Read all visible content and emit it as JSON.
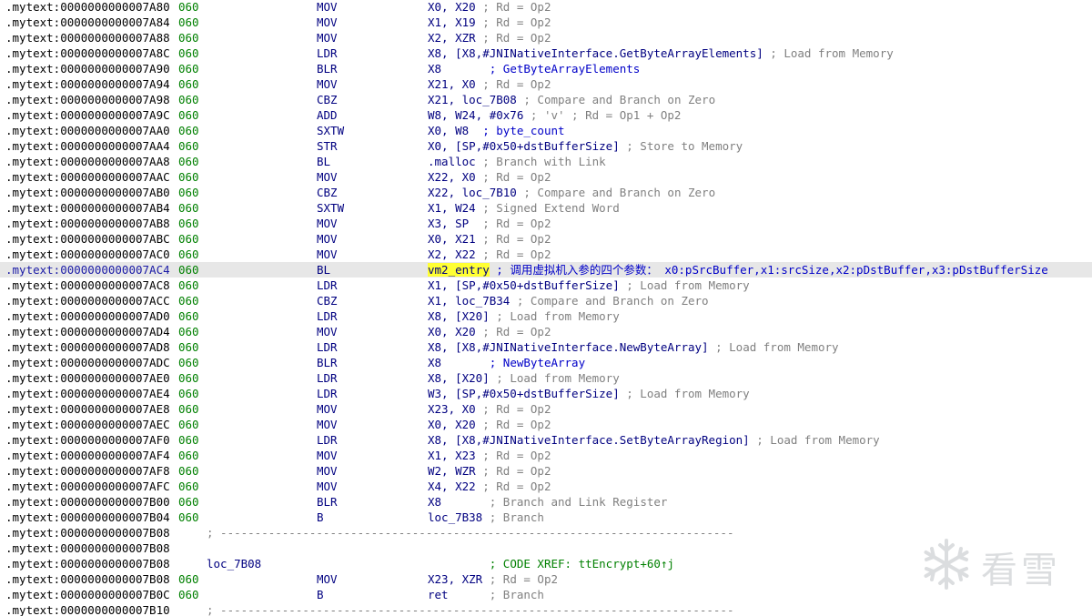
{
  "lines": [
    {
      "addr": ".mytext:0000000000007A80",
      "sp": "060",
      "mnem": "MOV",
      "ops": "X0, X20",
      "comment": "; Rd = Op2"
    },
    {
      "addr": ".mytext:0000000000007A84",
      "sp": "060",
      "mnem": "MOV",
      "ops": "X1, X19",
      "comment": "; Rd = Op2"
    },
    {
      "addr": ".mytext:0000000000007A88",
      "sp": "060",
      "mnem": "MOV",
      "ops": "X2, XZR",
      "comment": "; Rd = Op2"
    },
    {
      "addr": ".mytext:0000000000007A8C",
      "sp": "060",
      "mnem": "LDR",
      "ops": "X8, [X8,#JNINativeInterface.GetByteArrayElements]",
      "comment": "; Load from Memory"
    },
    {
      "addr": ".mytext:0000000000007A90",
      "sp": "060",
      "mnem": "BLR",
      "ops": "X8      ",
      "comment": "; GetByteArrayElements",
      "ctype": "blue"
    },
    {
      "addr": ".mytext:0000000000007A94",
      "sp": "060",
      "mnem": "MOV",
      "ops": "X21, X0",
      "comment": "; Rd = Op2"
    },
    {
      "addr": ".mytext:0000000000007A98",
      "sp": "060",
      "mnem": "CBZ",
      "ops": "X21, loc_7B08",
      "comment": "; Compare and Branch on Zero"
    },
    {
      "addr": ".mytext:0000000000007A9C",
      "sp": "060",
      "mnem": "ADD",
      "ops": "W8, W24, #0x76",
      "comment": "; 'v' ; Rd = Op1 + Op2"
    },
    {
      "addr": ".mytext:0000000000007AA0",
      "sp": "060",
      "mnem": "SXTW",
      "ops": "X0, W8 ",
      "comment": "; byte_count",
      "ctype": "blue"
    },
    {
      "addr": ".mytext:0000000000007AA4",
      "sp": "060",
      "mnem": "STR",
      "ops": "X0, [SP,#0x50+dstBufferSize]",
      "comment": "; Store to Memory"
    },
    {
      "addr": ".mytext:0000000000007AA8",
      "sp": "060",
      "mnem": "BL",
      "ops": ".malloc",
      "comment": "; Branch with Link"
    },
    {
      "addr": ".mytext:0000000000007AAC",
      "sp": "060",
      "mnem": "MOV",
      "ops": "X22, X0",
      "comment": "; Rd = Op2"
    },
    {
      "addr": ".mytext:0000000000007AB0",
      "sp": "060",
      "mnem": "CBZ",
      "ops": "X22, loc_7B10",
      "comment": "; Compare and Branch on Zero"
    },
    {
      "addr": ".mytext:0000000000007AB4",
      "sp": "060",
      "mnem": "SXTW",
      "ops": "X1, W24",
      "comment": "; Signed Extend Word"
    },
    {
      "addr": ".mytext:0000000000007AB8",
      "sp": "060",
      "mnem": "MOV",
      "ops": "X3, SP ",
      "comment": "; Rd = Op2"
    },
    {
      "addr": ".mytext:0000000000007ABC",
      "sp": "060",
      "mnem": "MOV",
      "ops": "X0, X21",
      "comment": "; Rd = Op2"
    },
    {
      "addr": ".mytext:0000000000007AC0",
      "sp": "060",
      "mnem": "MOV",
      "ops": "X2, X22",
      "comment": "; Rd = Op2"
    },
    {
      "addr": ".mytext:0000000000007AC4",
      "sp": "060",
      "mnem": "BL",
      "ops_hl": "vm2_entry",
      "ops": "",
      "comment": "; 调用虚拟机入参的四个参数： x0:pSrcBuffer,x1:srcSize,x2:pDstBuffer,x3:pDstBufferSize",
      "ctype": "blue",
      "current": true
    },
    {
      "addr": ".mytext:0000000000007AC8",
      "sp": "060",
      "mnem": "LDR",
      "ops": "X1, [SP,#0x50+dstBufferSize]",
      "comment": "; Load from Memory"
    },
    {
      "addr": ".mytext:0000000000007ACC",
      "sp": "060",
      "mnem": "CBZ",
      "ops": "X1, loc_7B34",
      "comment": "; Compare and Branch on Zero"
    },
    {
      "addr": ".mytext:0000000000007AD0",
      "sp": "060",
      "mnem": "LDR",
      "ops": "X8, [X20]",
      "comment": "; Load from Memory"
    },
    {
      "addr": ".mytext:0000000000007AD4",
      "sp": "060",
      "mnem": "MOV",
      "ops": "X0, X20",
      "comment": "; Rd = Op2"
    },
    {
      "addr": ".mytext:0000000000007AD8",
      "sp": "060",
      "mnem": "LDR",
      "ops": "X8, [X8,#JNINativeInterface.NewByteArray]",
      "comment": "; Load from Memory"
    },
    {
      "addr": ".mytext:0000000000007ADC",
      "sp": "060",
      "mnem": "BLR",
      "ops": "X8      ",
      "comment": "; NewByteArray",
      "ctype": "blue"
    },
    {
      "addr": ".mytext:0000000000007AE0",
      "sp": "060",
      "mnem": "LDR",
      "ops": "X8, [X20]",
      "comment": "; Load from Memory"
    },
    {
      "addr": ".mytext:0000000000007AE4",
      "sp": "060",
      "mnem": "LDR",
      "ops": "W3, [SP,#0x50+dstBufferSize]",
      "comment": "; Load from Memory"
    },
    {
      "addr": ".mytext:0000000000007AE8",
      "sp": "060",
      "mnem": "MOV",
      "ops": "X23, X0",
      "comment": "; Rd = Op2"
    },
    {
      "addr": ".mytext:0000000000007AEC",
      "sp": "060",
      "mnem": "MOV",
      "ops": "X0, X20",
      "comment": "; Rd = Op2"
    },
    {
      "addr": ".mytext:0000000000007AF0",
      "sp": "060",
      "mnem": "LDR",
      "ops": "X8, [X8,#JNINativeInterface.SetByteArrayRegion]",
      "comment": "; Load from Memory"
    },
    {
      "addr": ".mytext:0000000000007AF4",
      "sp": "060",
      "mnem": "MOV",
      "ops": "X1, X23",
      "comment": "; Rd = Op2"
    },
    {
      "addr": ".mytext:0000000000007AF8",
      "sp": "060",
      "mnem": "MOV",
      "ops": "W2, WZR",
      "comment": "; Rd = Op2"
    },
    {
      "addr": ".mytext:0000000000007AFC",
      "sp": "060",
      "mnem": "MOV",
      "ops": "X4, X22",
      "comment": "; Rd = Op2"
    },
    {
      "addr": ".mytext:0000000000007B00",
      "sp": "060",
      "mnem": "BLR",
      "ops": "X8      ",
      "comment": "; Branch and Link Register"
    },
    {
      "addr": ".mytext:0000000000007B04",
      "sp": "060",
      "mnem": "B",
      "ops": "loc_7B38",
      "comment": "; Branch"
    },
    {
      "addr": ".mytext:0000000000007B08",
      "sep": "; ---------------------------------------------------------------------------"
    },
    {
      "addr": ".mytext:0000000000007B08"
    },
    {
      "addr": ".mytext:0000000000007B08",
      "label": "loc_7B08",
      "ops": "        ",
      "comment": "; CODE XREF: ttEncrypt+60↑j",
      "ctype": "green"
    },
    {
      "addr": ".mytext:0000000000007B08",
      "sp": "060",
      "mnem": "MOV",
      "ops": "X23, XZR",
      "comment": "; Rd = Op2"
    },
    {
      "addr": ".mytext:0000000000007B0C",
      "sp": "060",
      "mnem": "B",
      "ops": "ret     ",
      "comment": "; Branch"
    },
    {
      "addr": ".mytext:0000000000007B10",
      "sep": "; ---------------------------------------------------------------------------"
    }
  ],
  "watermark": {
    "text": "看雪",
    "icon": "snowflake-icon"
  }
}
